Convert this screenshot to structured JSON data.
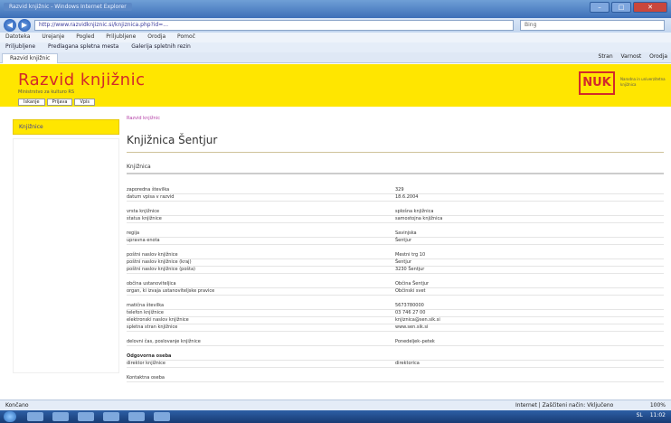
{
  "browser": {
    "window_title": "Razvid knjižnic - Windows Internet Explorer",
    "address": "http://www.razvidknjiznic.si/knjiznica.php?id=...",
    "search_placeholder": "Bing",
    "menu": [
      "Datoteka",
      "Urejanje",
      "Pogled",
      "Priljubljene",
      "Orodja",
      "Pomoč"
    ],
    "favorites_label": "Priljubljene",
    "favorites": [
      "Predlagana spletna mesta",
      "Galerija spletnih rezin"
    ],
    "tab_label": "Razvid knjižnic",
    "commands": [
      "Stran",
      "Varnost",
      "Orodja"
    ]
  },
  "header": {
    "site_title": "Razvid knjižnic",
    "site_subtitle": "Ministrstvo za kulturo RS",
    "logo_text": "NUK",
    "logo_caption": "Narodna in univerzitetna knjižnica",
    "tabs": [
      "Iskanje",
      "Prijava",
      "Vpis"
    ]
  },
  "sidebar": {
    "item": "Knjižnice"
  },
  "main": {
    "breadcrumb": "Razvid knjižnic",
    "library_title": "Knjižnica Šentjur",
    "section": "Knjižnica",
    "fields": [
      {
        "label": "zaporedna številka",
        "value": "329"
      },
      {
        "label": "datum vpisa v razvid",
        "value": "18.6.2004"
      },
      {
        "label": "",
        "value": ""
      },
      {
        "label": "vrsta knjižnice",
        "value": "splošna knjižnica"
      },
      {
        "label": "status knjižnice",
        "value": "samostojna knjižnica"
      },
      {
        "label": "",
        "value": ""
      },
      {
        "label": "regija",
        "value": "Savinjska"
      },
      {
        "label": "upravna enota",
        "value": "Šentjur"
      },
      {
        "label": "",
        "value": ""
      },
      {
        "label": "poštni naslov knjižnice",
        "value": "Mestni trg 10"
      },
      {
        "label": "poštni naslov knjižnice (kraj)",
        "value": "Šentjur"
      },
      {
        "label": "poštni naslov knjižnice (pošta)",
        "value": "3230 Šentjur"
      },
      {
        "label": "",
        "value": ""
      },
      {
        "label": "občina ustanoviteljica",
        "value": "Občina Šentjur"
      },
      {
        "label": "organ, ki izvaja ustanoviteljske pravice",
        "value": "Občinski svet"
      },
      {
        "label": "",
        "value": ""
      },
      {
        "label": "matična številka",
        "value": "5673780000"
      },
      {
        "label": "telefon knjižnice",
        "value": "03 746 27 00"
      },
      {
        "label": "elektronski naslov knjižnice",
        "value": "knjiznica@sen.sik.si"
      },
      {
        "label": "spletna stran knjižnice",
        "value": "www.sen.sik.si"
      },
      {
        "label": "",
        "value": ""
      },
      {
        "label": "delovni čas, poslovanje knjižnice",
        "value": "Ponedeljek–petek"
      },
      {
        "label": "",
        "value": ""
      },
      {
        "label": "Odgovorna oseba",
        "value": "",
        "bold": true
      },
      {
        "label": "direktor knjižnice",
        "value": "direktorica"
      },
      {
        "label": "",
        "value": ""
      },
      {
        "label": "Kontaktna oseba",
        "value": ""
      }
    ]
  },
  "status": {
    "left": "Končano",
    "zone": "Internet | Zaščiteni način: Vključeno",
    "zoom": "100%"
  },
  "taskbar": {
    "lang": "SL",
    "time": "11:02"
  },
  "colors": {
    "header_yellow": "#ffe600",
    "title_red": "#d22a2a",
    "link_purple": "#b33ea6"
  }
}
